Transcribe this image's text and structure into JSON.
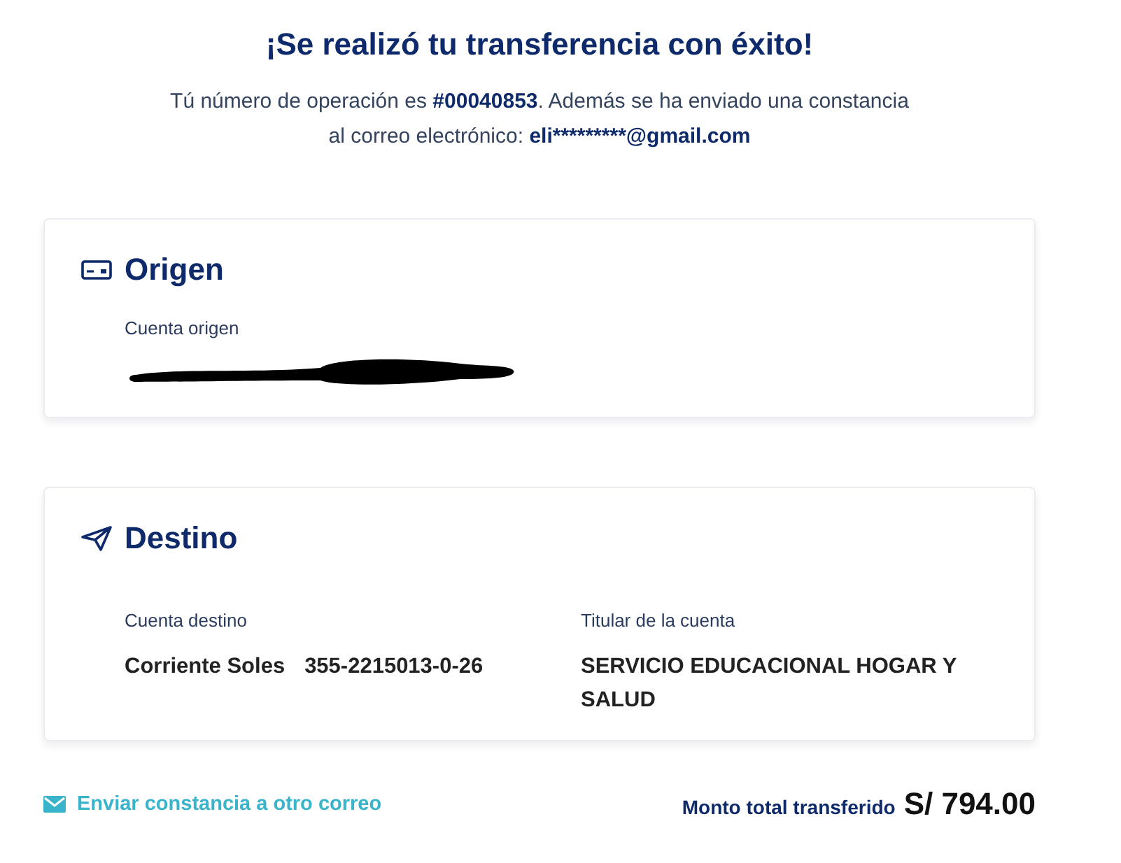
{
  "header": {
    "title": "¡Se realizó tu transferencia con éxito!",
    "message_parts": [
      {
        "text": "Tú número de operación es ",
        "bold": false
      },
      {
        "text": "#00040853",
        "bold": true
      },
      {
        "text": ". Además se ha enviado una constancia al correo electrónico: ",
        "bold": false
      },
      {
        "text": "eli*********@gmail.com",
        "bold": true
      }
    ]
  },
  "sections": [
    {
      "kind": "origin",
      "title": "Origen",
      "fields": [
        {
          "label": "Cuenta origen",
          "redacted": true
        }
      ]
    },
    {
      "kind": "destination",
      "title": "Destino",
      "fields": [
        {
          "label": "Cuenta destino",
          "value_parts": [
            "Corriente Soles",
            "355-2215013-0-26"
          ]
        },
        {
          "label": "Titular de la cuenta",
          "value_parts": [
            "SERVICIO EDUCACIONAL HOGAR Y SALUD"
          ]
        }
      ]
    }
  ],
  "footer": {
    "link": "Enviar constancia a otro correo",
    "total_label": "Monto total transferido",
    "total_amount": "S/ 794.00"
  }
}
